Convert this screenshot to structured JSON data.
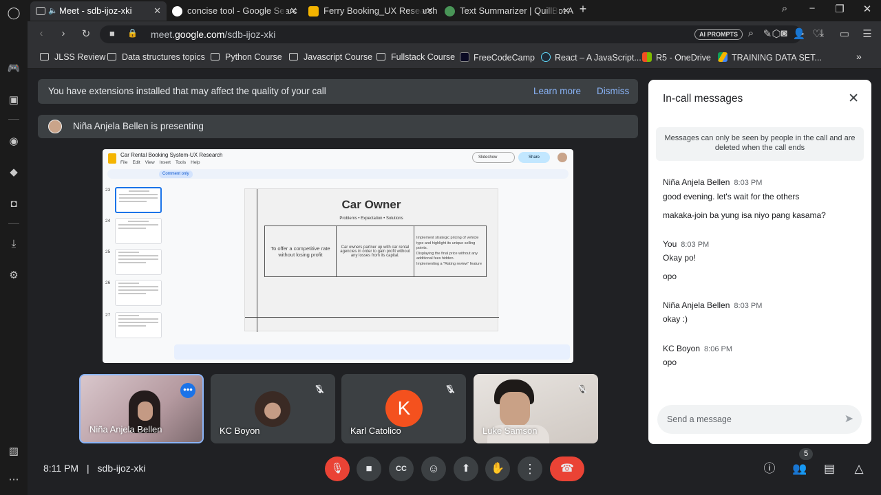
{
  "browser": {
    "tabs": [
      {
        "title": "Meet - sdb-ijoz-xki",
        "active": true
      },
      {
        "title": "concise tool - Google Searc",
        "active": false
      },
      {
        "title": "Ferry Booking_UX Research",
        "active": false
      },
      {
        "title": "Text Summarizer | QuillBot A",
        "active": false
      }
    ],
    "url_prefix": "meet.",
    "url_domain": "google.com",
    "url_path": "/sdb-ijoz-xki",
    "ai_prompts": "AI PROMPTS",
    "bookmarks": [
      "JLSS Review",
      "Data structures topics",
      "Python Course",
      "Javascript Course",
      "Fullstack Course",
      "FreeCodeCamp",
      "React – A JavaScript...",
      "R5 - OneDrive",
      "TRAINING DATA SET..."
    ],
    "bookmark_more": "»"
  },
  "meet": {
    "notice_text": "You have extensions installed that may affect the quality of your call",
    "learn_more": "Learn more",
    "dismiss": "Dismiss",
    "presenting_text": "Niña Anjela Bellen is presenting",
    "time": "8:11 PM",
    "separator": "|",
    "meeting_code": "sdb-ijoz-xki",
    "participant_count": "5",
    "shared_screen": {
      "doc_title": "Car Rental Booking System-UX Research",
      "menu": [
        "File",
        "Edit",
        "View",
        "Insert",
        "Tools",
        "Help"
      ],
      "comment_only": "Comment only",
      "slideshow": "Slideshow",
      "share": "Share",
      "thumb_numbers": [
        "23",
        "24",
        "25",
        "26",
        "27"
      ],
      "slide_title": "Car Owner",
      "slide_subtitle": "Problems • Expectation • Solutions",
      "problem": "To offer a competitive rate without losing profit",
      "expectation": "Car owners partner up with car rental agencies in order to gain profit without any losses from its capital.",
      "solutions": [
        "Implement strategic pricing of vehicle type and highlight its unique selling points.",
        "Displaying the final price without any additional fees hidden.",
        "Implementing a \"Rating review\" feature"
      ]
    },
    "participants": [
      {
        "name": "Niña Anjela Bellen",
        "active": true
      },
      {
        "name": "KC Boyon"
      },
      {
        "name": "Karl Catolico",
        "initial": "K"
      },
      {
        "name": "Luke Samson"
      }
    ]
  },
  "chat": {
    "title": "In-call messages",
    "info": "Messages can only be seen by people in the call and are deleted when the call ends",
    "messages": [
      {
        "sender": "Niña Anjela Bellen",
        "time": "8:03 PM",
        "texts": [
          "good evening. let's wait for the others",
          "makaka-join ba yung isa niyo pang kasama?"
        ]
      },
      {
        "sender": "You",
        "time": "8:03 PM",
        "texts": [
          "Okay po!",
          "opo"
        ]
      },
      {
        "sender": "Niña Anjela Bellen",
        "time": "8:03 PM",
        "texts": [
          "okay :)"
        ]
      },
      {
        "sender": "KC Boyon",
        "time": "8:06 PM",
        "texts": [
          "opo"
        ]
      }
    ],
    "input_placeholder": "Send a message"
  },
  "colors": {
    "accent_blue": "#8ab4f8",
    "end_call_red": "#ea4335",
    "avatar_orange": "#f4511e",
    "active_tile_border": "#8ab4f8"
  }
}
